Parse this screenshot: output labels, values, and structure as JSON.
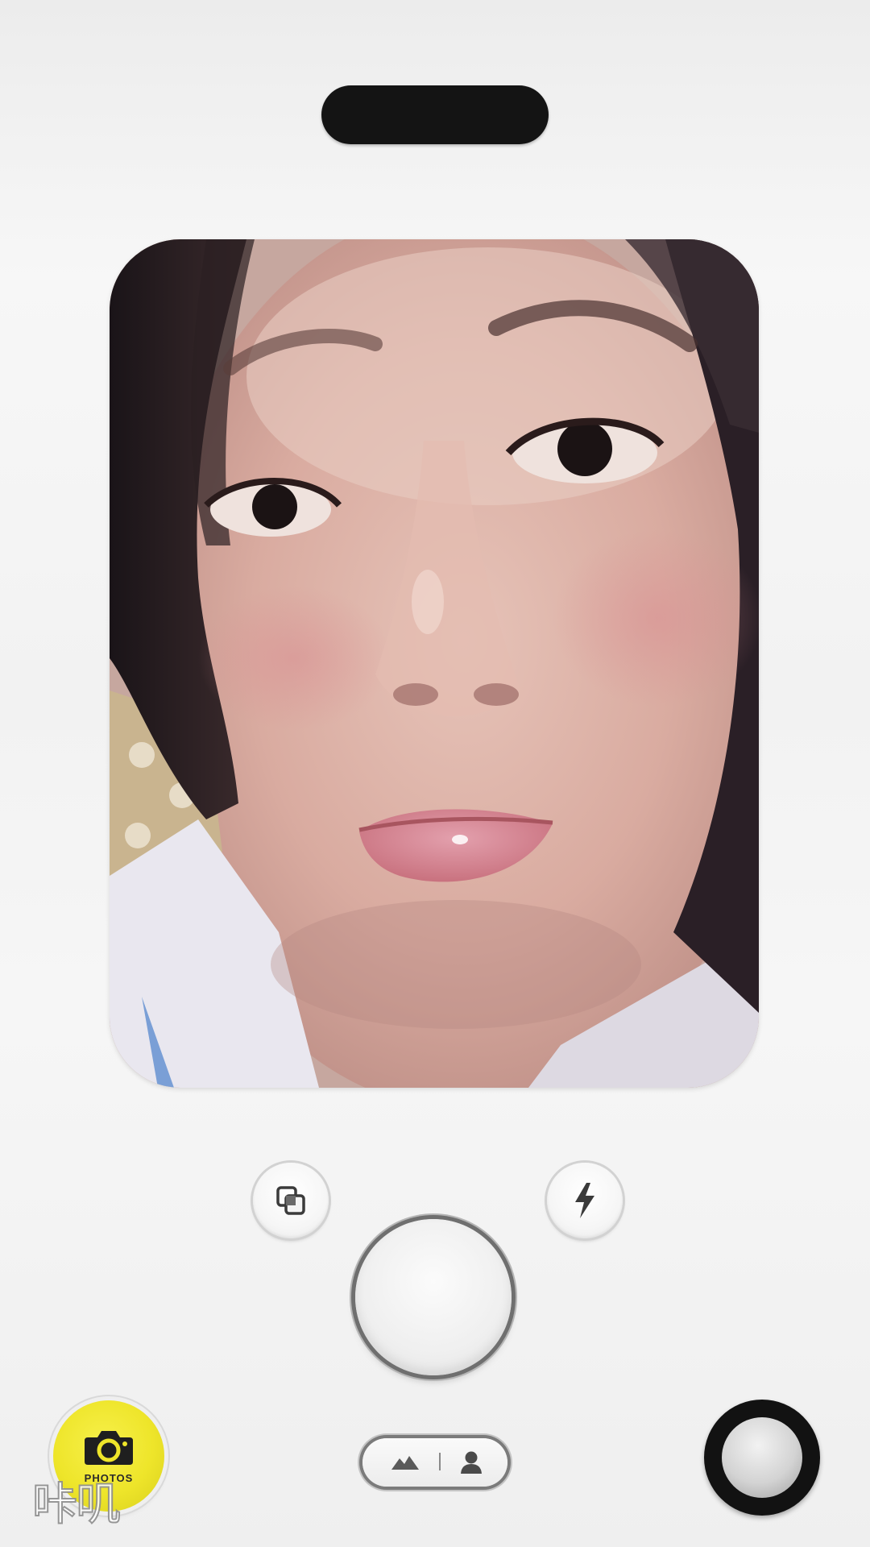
{
  "photos_button": {
    "label": "PHOTOS",
    "color": "#eee52a",
    "icon": "camera-icon"
  },
  "watermark": {
    "text": "咔叽"
  },
  "controls": {
    "flip_icon": "layers-flip-icon",
    "flash_icon": "lightning-bolt-icon",
    "mode_left_icon": "mountain-landscape-icon",
    "mode_right_icon": "person-portrait-icon"
  },
  "colors": {
    "notch": "#141414",
    "ring": "#121212",
    "background": "#f2f2f2"
  }
}
